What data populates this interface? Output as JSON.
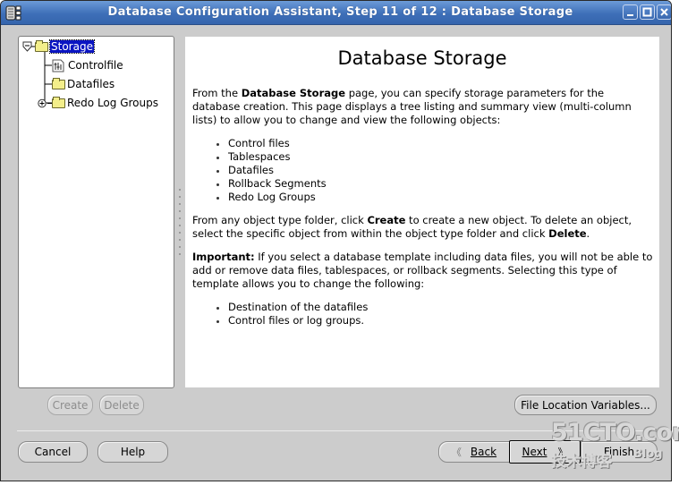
{
  "window": {
    "title": "Database Configuration Assistant, Step 11 of 12 : Database Storage",
    "controls": [
      "minimize",
      "maximize",
      "close"
    ]
  },
  "tree": {
    "items": [
      {
        "label": "Storage",
        "icon": "folder-icon",
        "expander": "collapse",
        "selected": true,
        "level": 0
      },
      {
        "label": "Controlfile",
        "icon": "controlfile-icon",
        "expander": null,
        "selected": false,
        "level": 1
      },
      {
        "label": "Datafiles",
        "icon": "folder-icon",
        "expander": null,
        "selected": false,
        "level": 1
      },
      {
        "label": "Redo Log Groups",
        "icon": "folder-icon",
        "expander": "expand",
        "selected": false,
        "level": 1
      }
    ]
  },
  "content": {
    "title": "Database Storage",
    "para1_a": "From the ",
    "para1_bold": "Database Storage",
    "para1_b": " page, you can specify storage parameters for the database creation. This page displays a tree listing and summary view (multi-column lists) to allow you to change and view the following objects:",
    "list1": [
      "Control files",
      "Tablespaces",
      "Datafiles",
      "Rollback Segments",
      "Redo Log Groups"
    ],
    "para2_a": "From any object type folder, click ",
    "para2_bold1": "Create",
    "para2_b": " to create a new object. To delete an object, select the specific object from within the object type folder and click ",
    "para2_bold2": "Delete",
    "para2_c": ".",
    "para3_bold": "Important:",
    "para3_a": " If you select a database template including data files, you will not be able to add or remove data files, tablespaces, or rollback segments. Selecting this type of template allows you to change the following:",
    "list2": [
      "Destination of the datafiles",
      "Control files or log groups."
    ]
  },
  "buttons": {
    "create": "Create",
    "delete": "Delete",
    "file_location": "File Location Variables...",
    "cancel": "Cancel",
    "help": "Help",
    "back": "Back",
    "back_arrow": "《",
    "next": "Next",
    "next_arrow": "》",
    "finish": "Finish"
  },
  "watermark": {
    "site": "51CTO.com",
    "subtitle": "技术博客",
    "blog": "Blog"
  }
}
